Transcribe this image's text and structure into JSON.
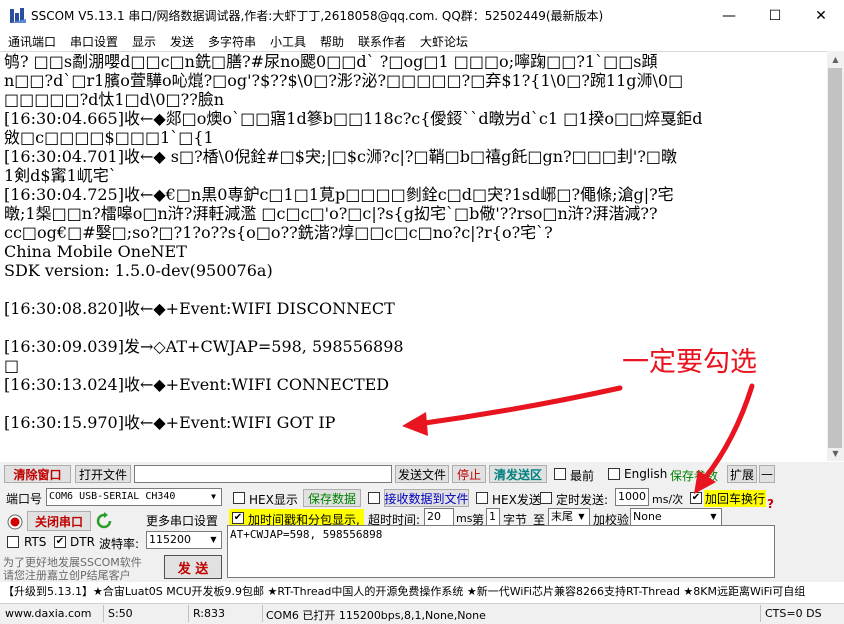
{
  "window": {
    "title": "SSCOM V5.13.1 串口/网络数据调试器,作者:大虾丁丁,2618058@qq.com. QQ群：52502449(最新版本)",
    "minimize_glyph": "—",
    "maximize_glyph": "☐",
    "close_glyph": "✕"
  },
  "menu": [
    "通讯端口",
    "串口设置",
    "显示",
    "发送",
    "多字符串",
    "小工具",
    "帮助",
    "联系作者",
    "大虾论坛"
  ],
  "receive": {
    "lines": [
      "鸲? □□s劀淜嚶d□□c□n銑□膳?#尿no颸0□□d` ?□og□1 □□□o;嚀踘□□?1`□□s蹞",
      "n□□?d`□r1臏o萓驊o吣熴?□og'?$??$\\0□?浵?泌?□□□□□?□弃$1?{1\\0□?踠11g浉\\0□",
      "□□□□□?d忲1□d\\0□??臉n",
      "[16:30:04.665]收←◆郯□o燠o`□□寤1d篸b□□118c?c{僾鋄``d暾屶d`c1 □1揆o□□焠戛鉅d",
      "敓□c□□□□$□□□1`□{1",
      "[16:30:04.701]收←◆ s□?楿\\0倪銓#□$宊;|□$c浉?c|?□鞘□b□禧g飥□gn?□□□刲'?□暾",
      "1剣d$寗1屼宅`",
      "[16:30:04.725]收←◆€□n黒0専鈩c□1□1莧p□□□□剼銓c□d□宊?1sd峫□?僶條;滄g|?宅",
      "暾;1椝□□n?檑嗥o□n浒?湃軠減濫 □c□c□'o?□c|?s{g抝宅`□b儆'??rso□n浒?湃湝減??",
      "cc□og€□#嫛□;so?□?1?o??s{o□o??銑湝?焞□□c□c□no?c|?r{o?宅`?",
      "China Mobile OneNET",
      "SDK version: 1.5.0-dev(950076a)",
      "",
      "[16:30:08.820]收←◆+Event:WIFI DISCONNECT",
      "",
      "[16:30:09.039]发→◇AT+CWJAP=598, 598556898",
      "□",
      "[16:30:13.024]收←◆+Event:WIFI CONNECTED",
      "",
      "[16:30:15.970]收←◆+Event:WIFI GOT IP"
    ]
  },
  "annotation": {
    "text": "一定要勾选",
    "color": "#e8141f"
  },
  "toolbar1": {
    "clear_window": "清除窗口",
    "open_file": "打开文件",
    "file_path": "",
    "send_file": "发送文件",
    "stop": "停止",
    "clear_send": "清发送区",
    "topmost": "最前",
    "english": "English",
    "save_params": "保存参数",
    "expand": "扩展",
    "collapse": "—"
  },
  "port": {
    "port_label": "端口号",
    "port_value": "COM6 USB-SERIAL CH340",
    "close_port": "关闭串口",
    "more_settings": "更多串口设置",
    "rts": "RTS",
    "dtr": "DTR",
    "dtr_checked": "✔",
    "baud_label": "波特率:",
    "baud_value": "115200",
    "promo1": "为了更好地发展SSCOM软件",
    "promo2": "请您注册嘉立创P结尾客户",
    "send_btn": "发 送"
  },
  "options": {
    "hex_display": "HEX显示",
    "save_data": "保存数据",
    "recv_to_file": "接收数据到文件",
    "hex_send": "HEX发送",
    "timed_send": "定时发送:",
    "interval_value": "1000",
    "interval_unit": "ms/次",
    "append_crlf": "加回车换行",
    "append_crlf_checked": "✔",
    "timestamp": "加时间戳和分包显示,",
    "timestamp_checked": "✔",
    "timeout_label": "超时时间:",
    "timeout_value": "20",
    "timeout_unit": "ms",
    "byte_prefix": "第",
    "byte_value": "1",
    "byte_suffix": "字节",
    "to_label": "至",
    "to_value": "末尾",
    "checksum_label": "加校验",
    "checksum_value": "None",
    "help_glyph": "?"
  },
  "send": {
    "content": "AT+CWJAP=598, 598556898"
  },
  "adbar": {
    "text": "【升级到5.13.1】★合宙Luat0S MCU开发板9.9包邮 ★RT-Thread中国人的开源免费操作系统 ★新一代WiFi芯片兼容8266支持RT-Thread ★8KM远距离WiFi可自组"
  },
  "status": {
    "website": "www.daxia.com",
    "sent": "S:50",
    "received": "R:833",
    "port_status": "COM6 已打开  115200bps,8,1,None,None",
    "cts": "CTS=0 DS"
  }
}
